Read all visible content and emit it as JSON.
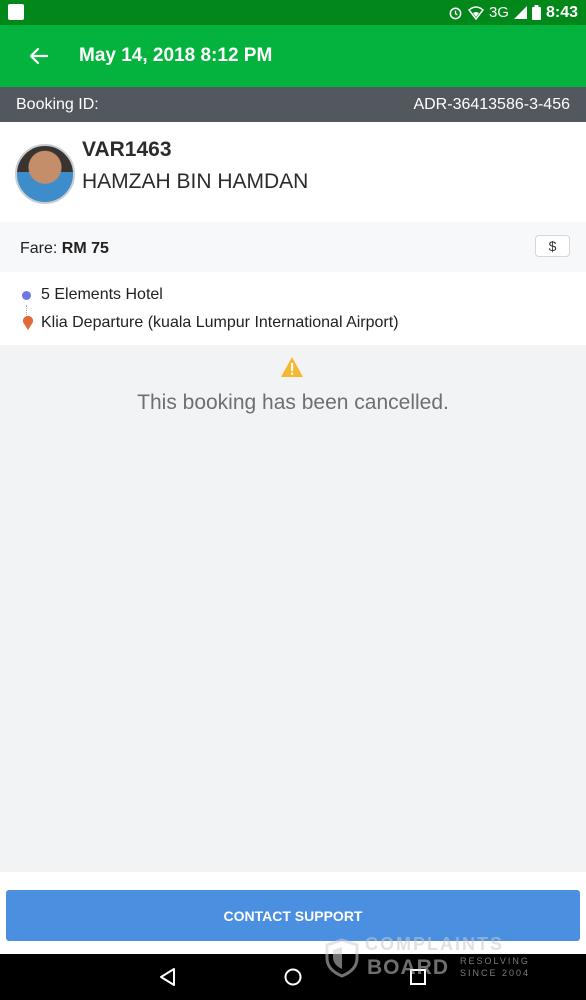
{
  "status_bar": {
    "network": "3G",
    "time": "8:43",
    "icons": [
      "notification-icon",
      "alarm-icon",
      "wifi-icon",
      "signal-icon",
      "battery-icon"
    ]
  },
  "app_bar": {
    "title": "May 14, 2018 8:12 PM",
    "back_icon": "arrow-left-icon"
  },
  "booking": {
    "label": "Booking ID:",
    "id": "ADR-36413586-3-456"
  },
  "driver": {
    "plate": "VAR1463",
    "name": "HAMZAH BIN HAMDAN"
  },
  "fare": {
    "label": "Fare:",
    "amount": "RM 75",
    "icon_label": "$"
  },
  "route": {
    "pickup": "5 Elements Hotel",
    "dropoff": "Klia Departure (kuala Lumpur International Airport)"
  },
  "status_message": "This booking has been cancelled.",
  "contact_button": "CONTACT SUPPORT",
  "watermark": {
    "line1": "COMPLAINTS",
    "line2": "BOARD",
    "tag1": "RESOLVING",
    "tag2": "SINCE 2004"
  },
  "colors": {
    "status_bar": "#02871b",
    "app_bar": "#04b33e",
    "booking_bar": "#53575e",
    "button": "#4a8fe0",
    "warning": "#f5b82e"
  }
}
